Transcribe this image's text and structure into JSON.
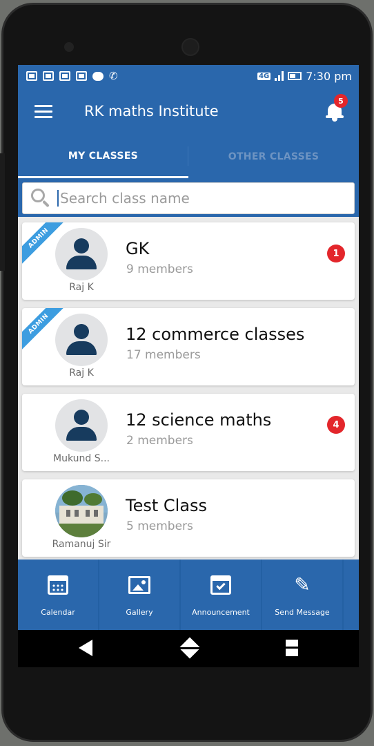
{
  "status_bar": {
    "network": "4G",
    "time": "7:30 pm"
  },
  "app_bar": {
    "title": "RK maths Institute",
    "notification_count": "5"
  },
  "tabs": [
    {
      "label": "MY CLASSES",
      "active": true
    },
    {
      "label": "OTHER CLASSES",
      "active": false
    }
  ],
  "search": {
    "placeholder": "Search class name",
    "value": ""
  },
  "classes": [
    {
      "name": "GK",
      "members": "9 members",
      "owner": "Raj K",
      "admin_label": "ADMIN",
      "badge": "1",
      "avatar": "person-icon"
    },
    {
      "name": "12 commerce classes",
      "members": "17 members",
      "owner": "Raj K",
      "admin_label": "ADMIN",
      "badge": "",
      "avatar": "person-icon"
    },
    {
      "name": "12 science maths",
      "members": "2 members",
      "owner": "Mukund S...",
      "admin_label": "",
      "badge": "4",
      "avatar": "person-icon"
    },
    {
      "name": "Test Class",
      "members": "5 members",
      "owner": "Ramanuj Sir",
      "admin_label": "",
      "badge": "",
      "avatar": "class-photo"
    }
  ],
  "bottom_nav": [
    {
      "label": "Calendar",
      "icon": "calendar-icon"
    },
    {
      "label": "Gallery",
      "icon": "gallery-icon"
    },
    {
      "label": "Announcement",
      "icon": "announcement-icon"
    },
    {
      "label": "Send Message",
      "icon": "pencil-icon"
    }
  ],
  "colors": {
    "primary": "#2a67ac",
    "badge": "#e3262b",
    "admin_ribbon": "#3d9de0",
    "avatar_figure": "#173b5e"
  }
}
